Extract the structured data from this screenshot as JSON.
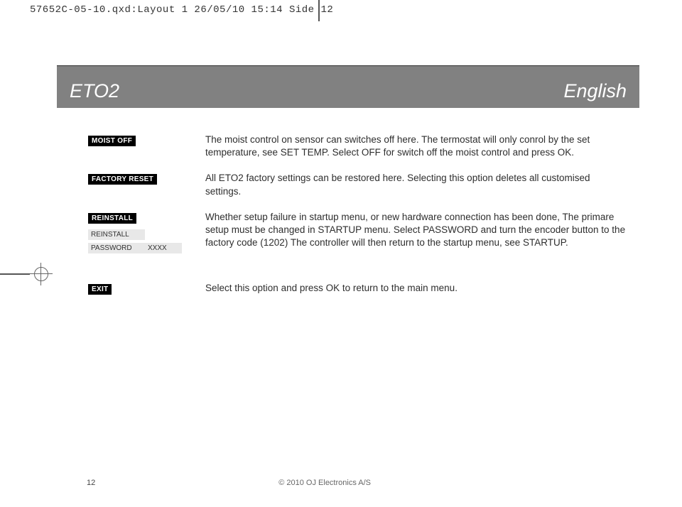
{
  "print_header": "57652C-05-10.qxd:Layout 1  26/05/10  15:14  Side 12",
  "title_band": {
    "left": "ETO2",
    "right": "English"
  },
  "rows": [
    {
      "tag": "MOIST OFF",
      "text": "The moist control on sensor can switches off here. The termostat will only conrol by the set temperature, see SET TEMP. Select OFF for switch off the moist control and press OK."
    },
    {
      "tag": "FACTORY RESET",
      "text": "All ETO2 factory settings can be restored here. Selecting this option deletes all customised settings."
    },
    {
      "tag": "REINSTALL",
      "sub": {
        "label": "REINSTALL",
        "label2": "PASSWORD",
        "value": "XXXX"
      },
      "text": "Whether setup failure in startup menu, or new hardware connection has been done, The primare setup must be changed in STARTUP menu. Select PASSWORD and turn the encoder button to the factory code (1202) The controller will then return to the startup menu, see STARTUP."
    },
    {
      "tag": "EXIT",
      "text": "Select this option and press OK to return to the main menu."
    }
  ],
  "footer": {
    "page": "12",
    "copyright": "© 2010 OJ Electronics A/S"
  }
}
